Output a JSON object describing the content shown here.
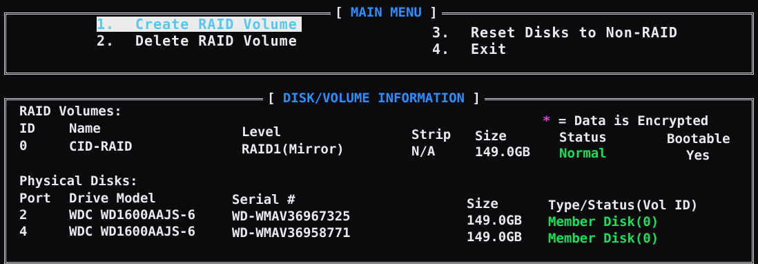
{
  "main_menu": {
    "title": "MAIN MENU",
    "items": [
      {
        "number": "1.",
        "label": "Create RAID Volume"
      },
      {
        "number": "2.",
        "label": "Delete RAID Volume"
      },
      {
        "number": "3.",
        "label": "Reset Disks to Non-RAID"
      },
      {
        "number": "4.",
        "label": "Exit"
      }
    ]
  },
  "disk_info": {
    "title": "DISK/VOLUME INFORMATION",
    "legend_star": "*",
    "legend_text": "= Data is Encrypted",
    "raid_volumes": {
      "heading": "RAID Volumes:",
      "headers": {
        "id": "ID",
        "name": "Name",
        "level": "Level",
        "strip": "Strip",
        "size": "Size",
        "status": "Status",
        "bootable": "Bootable"
      },
      "rows": [
        {
          "id": "0",
          "name": "CID-RAID",
          "level": "RAID1(Mirror)",
          "strip": "N/A",
          "size": "149.0GB",
          "status": "Normal",
          "bootable": "Yes"
        }
      ]
    },
    "physical_disks": {
      "heading": "Physical Disks:",
      "headers": {
        "port": "Port",
        "model": "Drive Model",
        "serial": "Serial #",
        "size": "Size",
        "type_status": "Type/Status(Vol ID)"
      },
      "rows": [
        {
          "port": "2",
          "model": "WDC WD1600AAJS-6",
          "serial": "WD-WMAV36967325",
          "size": "149.0GB",
          "type_status": "Member Disk(0)"
        },
        {
          "port": "4",
          "model": "WDC WD1600AAJS-6",
          "serial": "WD-WMAV36958771",
          "size": "149.0GB",
          "type_status": "Member Disk(0)"
        }
      ]
    }
  },
  "colors": {
    "title": "#2e8dff",
    "status_ok": "#19e05a",
    "encrypted_marker": "#e53bd8",
    "selection_bg": "#ececec",
    "selection_fg": "#55c8ea"
  }
}
